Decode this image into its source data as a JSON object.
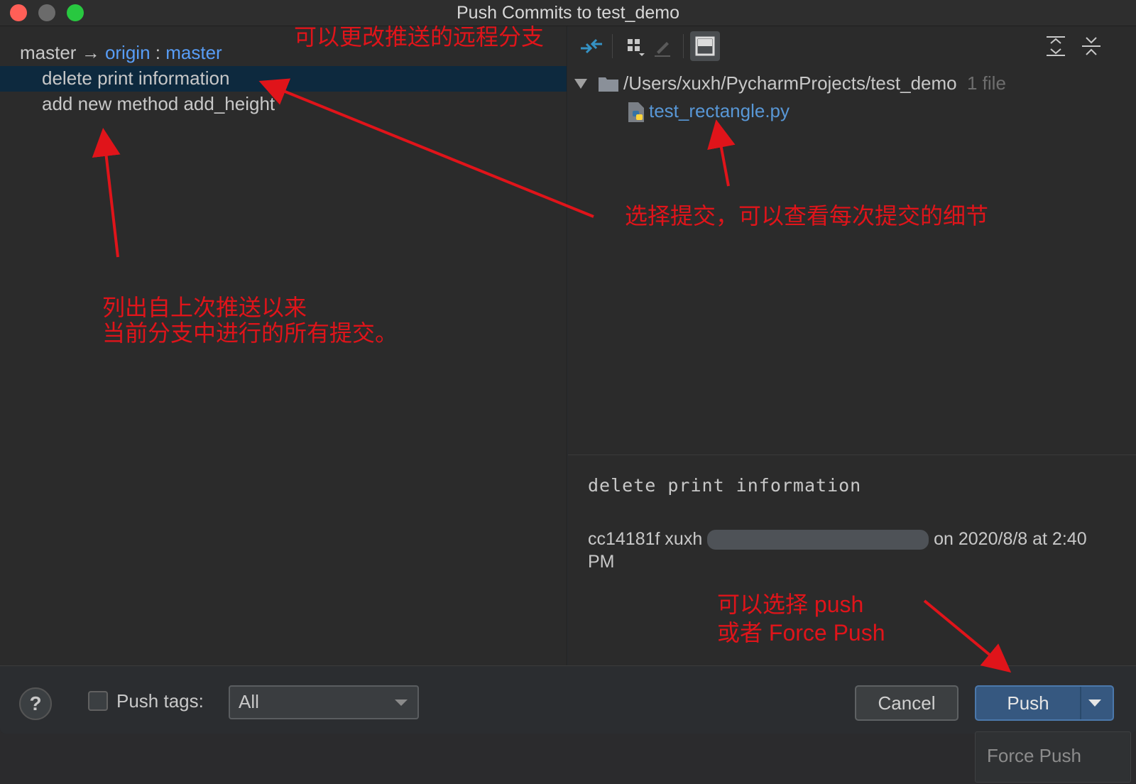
{
  "window": {
    "title": "Push Commits to test_demo"
  },
  "branch": {
    "local": "master",
    "arrow": "→",
    "remote": "origin",
    "separator": ":",
    "remote_branch": "master"
  },
  "commits": [
    {
      "message": "delete print information",
      "selected": true
    },
    {
      "message": "add new method add_height",
      "selected": false
    }
  ],
  "toolbar": {
    "icons": [
      "show-diff-icon",
      "group-by-icon",
      "edit-source-icon",
      "preview-diff-icon",
      "expand-all-icon",
      "collapse-all-icon"
    ]
  },
  "tree": {
    "root_path": "/Users/xuxh/PycharmProjects/test_demo",
    "root_count": "1 file",
    "file_name": "test_rectangle.py"
  },
  "details": {
    "message": "delete print information",
    "hash_author": "cc14181f xuxh",
    "date_suffix": "on 2020/8/8 at 2:40 PM"
  },
  "bottom": {
    "help": "?",
    "push_tags_label": "Push tags:",
    "push_tags_value": "All",
    "cancel_label": "Cancel",
    "push_label": "Push",
    "dropdown_item": "Force Push"
  },
  "annotations": {
    "remote_branch_note": "可以更改推送的远程分支",
    "select_commit_note": "选择提交，可以查看每次提交的细节",
    "list_note_line1": "列出自上次推送以来",
    "list_note_line2": "当前分支中进行的所有提交。",
    "push_note_line1": "可以选择 push",
    "push_note_line2": "或者 Force Push"
  },
  "colors": {
    "accent": "#589df6",
    "annotation": "#e0141a",
    "selection": "#0d293e",
    "push_button": "#365880"
  }
}
